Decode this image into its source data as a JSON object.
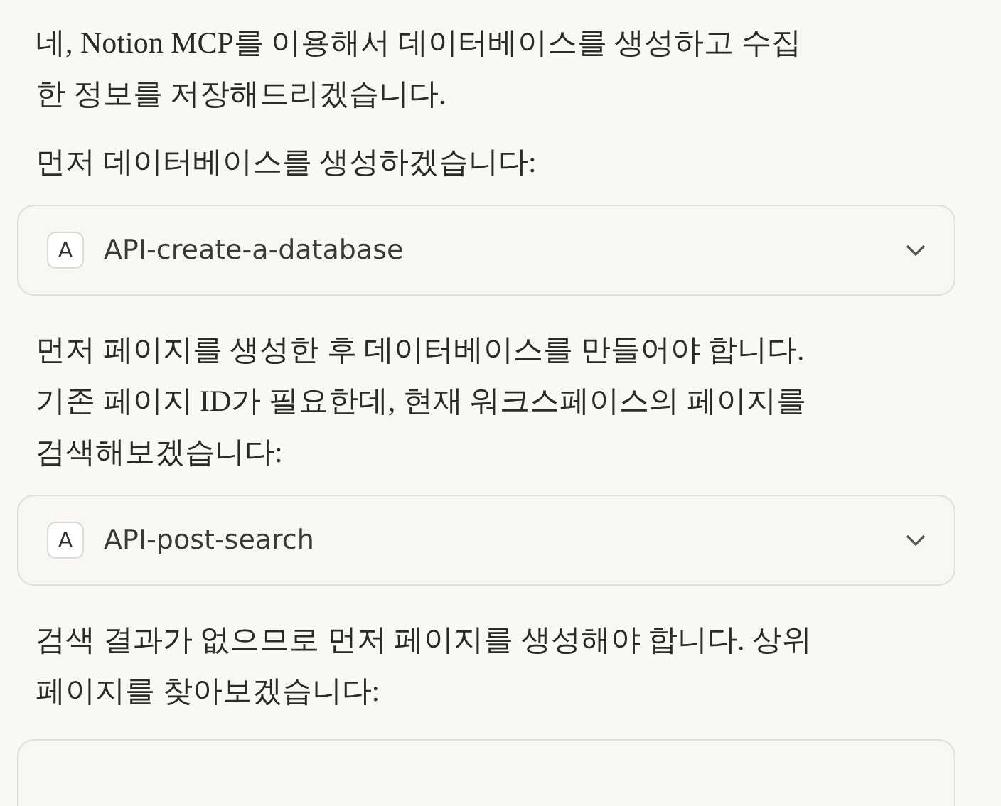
{
  "blocks": [
    {
      "kind": "text",
      "text": "네, Notion MCP를 이용해서 데이터베이스를 생성하고 수집\n한 정보를 저장해드리겠습니다."
    },
    {
      "kind": "text",
      "text": "먼저 데이터베이스를 생성하겠습니다:"
    },
    {
      "kind": "tool",
      "badge": "A",
      "name": "API-create-a-database",
      "expanded": false
    },
    {
      "kind": "text",
      "text": "먼저 페이지를 생성한 후 데이터베이스를 만들어야 합니다.\n기존 페이지 ID가 필요한데, 현재 워크스페이스의 페이지를\n검색해보겠습니다:"
    },
    {
      "kind": "tool",
      "badge": "A",
      "name": "API-post-search",
      "expanded": false
    },
    {
      "kind": "text",
      "text": "검색 결과가 없으므로 먼저 페이지를 생성해야 합니다. 상위\n페이지를 찾아보겠습니다:"
    },
    {
      "kind": "partial"
    }
  ]
}
